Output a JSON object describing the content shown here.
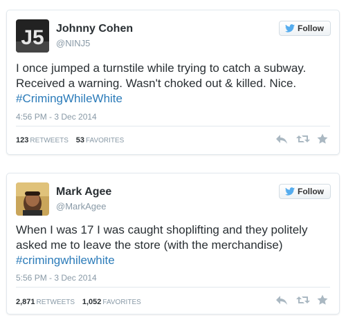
{
  "tweets": [
    {
      "name": "Johnny Cohen",
      "handle": "@NINJ5",
      "avatar_text": "J5",
      "follow_label": "Follow",
      "text_lines": [
        "I once jumped a turnstile while trying to catch a subway.",
        "Received a warning. Wasn't choked out & killed. Nice."
      ],
      "hashtag": "#CrimingWhileWhite",
      "time": "4:56 PM - 3 Dec 2014",
      "retweets_count": "123",
      "retweets_label": "RETWEETS",
      "favorites_count": "53",
      "favorites_label": "FAVORITES"
    },
    {
      "name": "Mark Agee",
      "handle": "@MarkAgee",
      "follow_label": "Follow",
      "text_lines": [
        "When I was 17 I was caught shoplifting and they politely",
        "asked me to leave the store (with the merchandise)"
      ],
      "hashtag": "#crimingwhilewhite",
      "time": "5:56 PM - 3 Dec 2014",
      "retweets_count": "2,871",
      "retweets_label": "RETWEETS",
      "favorites_count": "1,052",
      "favorites_label": "FAVORITES"
    }
  ],
  "icons": {
    "follow": "twitter-bird-icon",
    "reply": "reply-icon",
    "retweet": "retweet-icon",
    "favorite": "star-icon"
  },
  "colors": {
    "hashtag": "#2b7bb9",
    "follow_bird": "#55acee",
    "muted": "#8899a6",
    "icon": "#aab8c2"
  }
}
